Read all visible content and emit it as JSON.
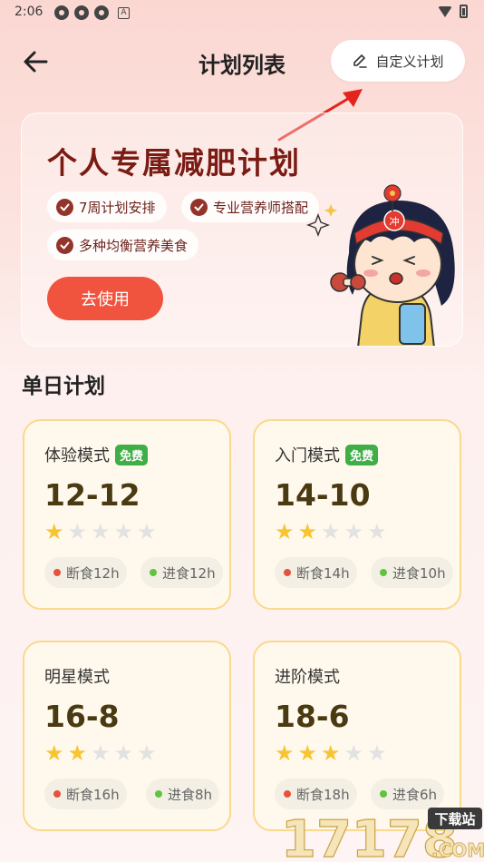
{
  "status_bar": {
    "time": "2:06",
    "a_icon": "A"
  },
  "header": {
    "title": "计划列表",
    "custom_plan_label": "自定义计划"
  },
  "banner": {
    "title": "个人专属减肥计划",
    "features": [
      "7周计划安排",
      "专业营养师搭配",
      "多种均衡营养美食"
    ],
    "use_button_label": "去使用",
    "mascot_badge": "冲"
  },
  "section": {
    "title": "单日计划"
  },
  "plans": [
    {
      "name": "体验模式",
      "badge": "免费",
      "ratio": "12-12",
      "rating": 1,
      "fast_label": "断食12h",
      "eat_label": "进食12h"
    },
    {
      "name": "入门模式",
      "badge": "免费",
      "ratio": "14-10",
      "rating": 2,
      "fast_label": "断食14h",
      "eat_label": "进食10h"
    },
    {
      "name": "明星模式",
      "badge": "",
      "ratio": "16-8",
      "rating": 2,
      "fast_label": "断食16h",
      "eat_label": "进食8h"
    },
    {
      "name": "进阶模式",
      "badge": "",
      "ratio": "18-6",
      "rating": 3,
      "fast_label": "断食18h",
      "eat_label": "进食6h"
    }
  ],
  "watermark": {
    "digits": "17178",
    "tag": "下载站",
    "suffix": ".COM"
  },
  "colors": {
    "accent": "#f0533e",
    "banner_title": "#7a1c14",
    "card_border": "#f9d98c",
    "star_on": "#f7c531",
    "fast_dot": "#e8513f",
    "eat_dot": "#62c33f",
    "free_badge": "#3fae46",
    "annotation_arrow": "#e3231c"
  }
}
